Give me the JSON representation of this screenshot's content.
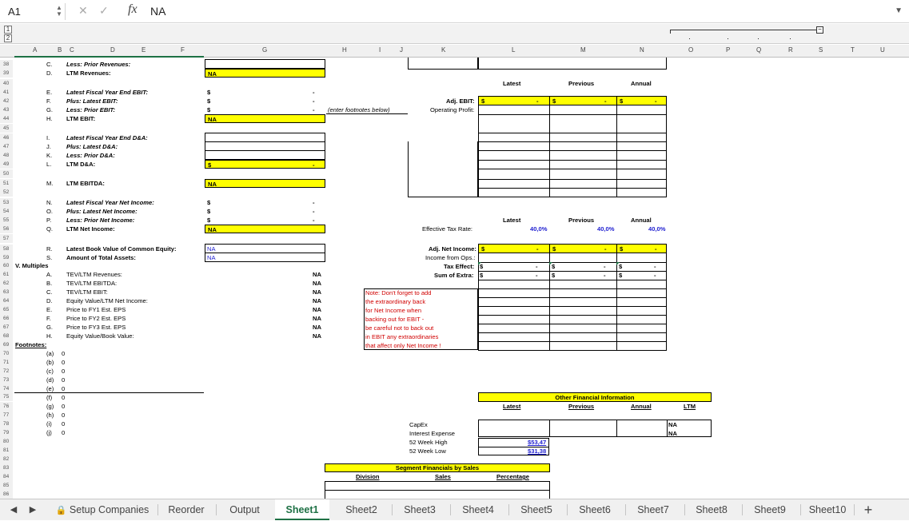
{
  "formula_bar": {
    "cell_ref": "A1",
    "fx": "fx",
    "value": "NA"
  },
  "outline_levels": [
    "1",
    "2"
  ],
  "columns": [
    "A",
    "B",
    "C",
    "D",
    "E",
    "F",
    "G",
    "H",
    "I",
    "J",
    "K",
    "L",
    "M",
    "N",
    "O",
    "P",
    "Q",
    "R",
    "S",
    "T",
    "U"
  ],
  "rows": [
    "38",
    "39",
    "40",
    "41",
    "42",
    "43",
    "44",
    "45",
    "46",
    "47",
    "48",
    "49",
    "50",
    "51",
    "52",
    "53",
    "54",
    "55",
    "56",
    "57",
    "58",
    "59",
    "60",
    "61",
    "62",
    "63",
    "64",
    "65",
    "66",
    "67",
    "68",
    "69",
    "70",
    "71",
    "72",
    "73",
    "74",
    "75",
    "76",
    "77",
    "78",
    "79",
    "80",
    "81",
    "82",
    "83",
    "84",
    "85",
    "86"
  ],
  "left": {
    "c_label": "C.",
    "c_text": "Less: Prior Revenues:",
    "d_label": "D.",
    "d_text": "LTM Revenues:",
    "d_val": "NA",
    "e_label": "E.",
    "e_text": "Latest Fiscal Year End EBIT:",
    "f_label": "F.",
    "f_text": "Plus: Latest EBIT:",
    "g_label": "G.",
    "g_text": "Less: Prior EBIT:",
    "h_label": "H.",
    "h_text": "LTM EBIT:",
    "h_val": "NA",
    "i_label": "I.",
    "i_text": "Latest Fiscal Year End D&A:",
    "j_label": "J.",
    "j_text": "Plus: Latest D&A:",
    "k_label": "K.",
    "k_text": "Less: Prior D&A:",
    "l_label": "L.",
    "l_text": "LTM D&A:",
    "m_label": "M.",
    "m_text": "LTM EBITDA:",
    "m_val": "NA",
    "n_label": "N.",
    "n_text": "Latest Fiscal Year Net Income:",
    "o_label": "O.",
    "o_text": "Plus: Latest Net Income:",
    "p_label": "P.",
    "p_text": "Less: Prior Net Income:",
    "q_label": "Q.",
    "q_text": "LTM Net Income:",
    "q_val": "NA",
    "r_label": "R.",
    "r_text": "Latest Book Value of Common Equity:",
    "r_val": "NA",
    "s_label": "S.",
    "s_text": "Amount of Total Assets:",
    "s_val": "NA",
    "dollar": "$",
    "dash": "-",
    "enter_fn": "(enter footnotes below)",
    "multiples_title": "V. Multiples",
    "multiples": [
      {
        "l": "A.",
        "t": "TEV/LTM Revenues:",
        "v": "NA"
      },
      {
        "l": "B.",
        "t": "TEV/LTM EBITDA:",
        "v": "NA"
      },
      {
        "l": "C.",
        "t": "TEV/LTM EBIT:",
        "v": "NA"
      },
      {
        "l": "D.",
        "t": "Equity Value/LTM Net Income:",
        "v": "NA"
      },
      {
        "l": "E.",
        "t": "Price to FY1 Est. EPS",
        "v": "NA"
      },
      {
        "l": "F.",
        "t": "Price to FY2 Est. EPS",
        "v": "NA"
      },
      {
        "l": "G.",
        "t": "Price to FY3 Est. EPS",
        "v": "NA"
      },
      {
        "l": "H.",
        "t": "Equity Value/Book Value:",
        "v": "NA"
      }
    ],
    "footnotes_title": "Footnotes:",
    "footnotes": [
      {
        "l": "(a)",
        "v": "0"
      },
      {
        "l": "(b)",
        "v": "0"
      },
      {
        "l": "(c)",
        "v": "0"
      },
      {
        "l": "(d)",
        "v": "0"
      },
      {
        "l": "(e)",
        "v": "0"
      },
      {
        "l": "(f)",
        "v": "0"
      },
      {
        "l": "(g)",
        "v": "0"
      },
      {
        "l": "(h)",
        "v": "0"
      },
      {
        "l": "(i)",
        "v": "0"
      },
      {
        "l": "(j)",
        "v": "0"
      }
    ]
  },
  "right": {
    "latest": "Latest",
    "previous": "Previous",
    "annual": "Annual",
    "adj_ebit": "Adj. EBIT:",
    "op_profit": "Operating Profit:",
    "eff_tax": "Effective Tax Rate:",
    "tax_latest": "40,0%",
    "tax_prev": "40,0%",
    "tax_annual": "40,0%",
    "adj_ni": "Adj. Net Income:",
    "inc_ops": "Income from Ops.:",
    "tax_effect": "Tax Effect:",
    "sum_extra": "Sum of Extra:",
    "note_lines": [
      "Note: Don't forget to add",
      "the extraordinary back",
      "for Net Income when",
      "backing out for EBIT -",
      "be careful not to back out",
      "in EBIT any extraordinaries",
      "that affect only Net Income !"
    ],
    "ofi_title": "Other Financial Information",
    "ltm": "LTM",
    "capex": "CapEx",
    "interest": "Interest Expense",
    "high52": "52 Week High",
    "low52": "52 Week Low",
    "capex_ltm": "NA",
    "interest_ltm": "NA",
    "high_val": "$53,47",
    "low_val": "$31,38",
    "seg_title": "Segment Financials by Sales",
    "division": "Division",
    "sales": "Sales",
    "percentage": "Percentage"
  },
  "tabs": [
    "Setup Companies",
    "Reorder",
    "Output",
    "Sheet1",
    "Sheet2",
    "Sheet3",
    "Sheet4",
    "Sheet5",
    "Sheet6",
    "Sheet7",
    "Sheet8",
    "Sheet9",
    "Sheet10"
  ],
  "active_tab": "Sheet1"
}
